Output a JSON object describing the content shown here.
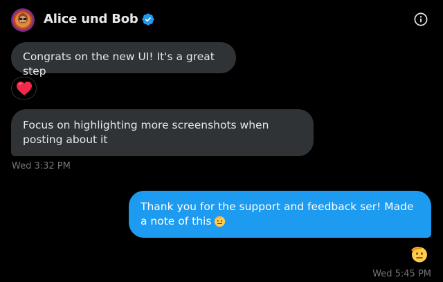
{
  "header": {
    "title": "Alice und Bob",
    "icons": {
      "avatar": "group-avatar",
      "verified": "verified-badge-icon",
      "info": "info-icon"
    }
  },
  "messages": [
    {
      "direction": "incoming",
      "text": "Congrats on the new UI! It's a great step"
    },
    {
      "direction": "incoming",
      "text": "Focus on highlighting more screenshots when posting about it"
    },
    {
      "direction": "outgoing",
      "text": "Thank you for the support and feedback ser! Made a note of this"
    }
  ],
  "reactions": {
    "first_message": "heart-emoji",
    "outgoing_message": "saluting-face-emoji"
  },
  "timestamps": {
    "incoming": "Wed 3:32 PM",
    "outgoing": "Wed 5:45 PM"
  },
  "colors": {
    "background": "#000000",
    "incoming_bubble": "#2f3336",
    "outgoing_bubble": "#1d9bf0",
    "verified": "#1d9bf0",
    "timestamp": "#71767b",
    "heart": "#f91880"
  }
}
